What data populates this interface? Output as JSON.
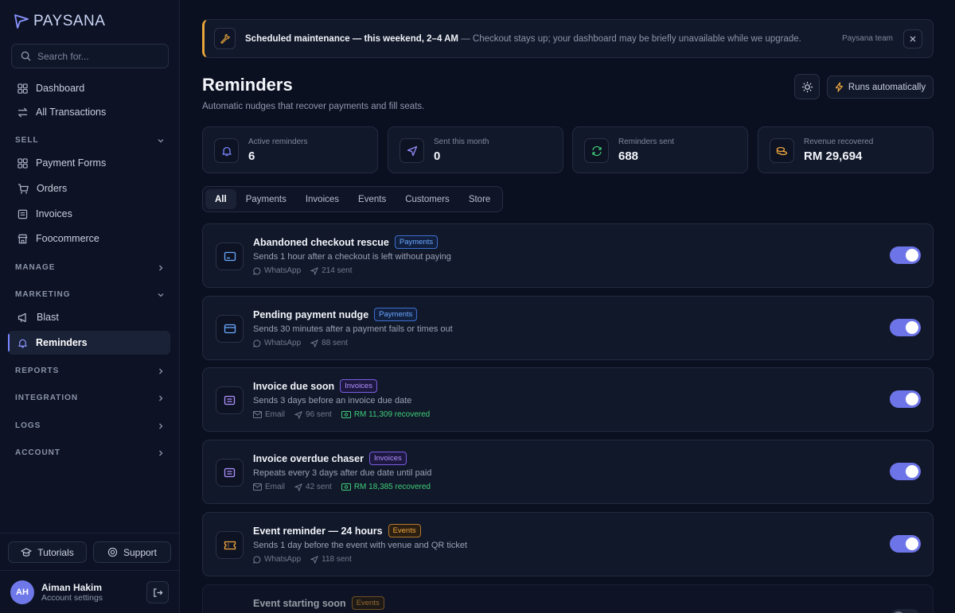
{
  "brand": {
    "name": "PAYSANA",
    "accent": "#6d74e8"
  },
  "search": {
    "placeholder": "Search for..."
  },
  "sidebar": {
    "top_items": [
      {
        "label": "Dashboard",
        "icon": "grid-icon"
      },
      {
        "label": "All Transactions",
        "icon": "swap-icon"
      }
    ],
    "sections": {
      "sell": {
        "label": "SELL",
        "items": [
          "Payment Forms",
          "Orders",
          "Invoices",
          "Foocommerce"
        ]
      },
      "manage": {
        "label": "MANAGE"
      },
      "marketing": {
        "label": "MARKETING",
        "items": [
          "Blast",
          "Reminders"
        ]
      },
      "reports": {
        "label": "REPORTS"
      },
      "integration": {
        "label": "INTEGRATION"
      },
      "logs": {
        "label": "LOGS"
      },
      "account": {
        "label": "ACCOUNT"
      }
    },
    "tutorials_label": "Tutorials",
    "support_label": "Support"
  },
  "user": {
    "initials": "AH",
    "name": "Aiman Hakim",
    "subtitle": "Account settings"
  },
  "banner": {
    "title": "Scheduled maintenance — this weekend, 2–4 AM",
    "message": " — Checkout stays up; your dashboard may be briefly unavailable while we upgrade.",
    "author": "Paysana team"
  },
  "page": {
    "title": "Reminders",
    "subtitle": "Automatic nudges that recover payments and fill seats.",
    "runs_label": "Runs automatically"
  },
  "stats": [
    {
      "label": "Active reminders",
      "value": "6",
      "icon": "bell-icon",
      "color": "#6d74e8"
    },
    {
      "label": "Sent this month",
      "value": "0",
      "icon": "send-icon",
      "color": "#8a7dff"
    },
    {
      "label": "Reminders sent",
      "value": "688",
      "icon": "refresh-icon",
      "color": "#3fcf7a"
    },
    {
      "label": "Revenue recovered",
      "value": "RM 29,694",
      "icon": "coins-icon",
      "color": "#f0a63c"
    }
  ],
  "tabs": [
    "All",
    "Payments",
    "Invoices",
    "Events",
    "Customers",
    "Store"
  ],
  "reminders": [
    {
      "title": "Abandoned checkout rescue",
      "tag": "Payments",
      "desc": "Sends 1 hour after a checkout is left without paying",
      "channel": "WhatsApp",
      "sent": "214 sent",
      "recovered": "",
      "enabled": true
    },
    {
      "title": "Pending payment nudge",
      "tag": "Payments",
      "desc": "Sends 30 minutes after a payment fails or times out",
      "channel": "WhatsApp",
      "sent": "88 sent",
      "recovered": "",
      "enabled": true
    },
    {
      "title": "Invoice due soon",
      "tag": "Invoices",
      "desc": "Sends 3 days before an invoice due date",
      "channel": "Email",
      "sent": "96 sent",
      "recovered": "RM 11,309 recovered",
      "enabled": true
    },
    {
      "title": "Invoice overdue chaser",
      "tag": "Invoices",
      "desc": "Repeats every 3 days after due date until paid",
      "channel": "Email",
      "sent": "42 sent",
      "recovered": "RM 18,385 recovered",
      "enabled": true
    },
    {
      "title": "Event reminder — 24 hours",
      "tag": "Events",
      "desc": "Sends 1 day before the event with venue and QR ticket",
      "channel": "WhatsApp",
      "sent": "118 sent",
      "recovered": "",
      "enabled": true
    },
    {
      "title": "Event starting soon",
      "tag": "Events",
      "desc": "",
      "channel": "",
      "sent": "",
      "recovered": "",
      "enabled": false
    }
  ]
}
